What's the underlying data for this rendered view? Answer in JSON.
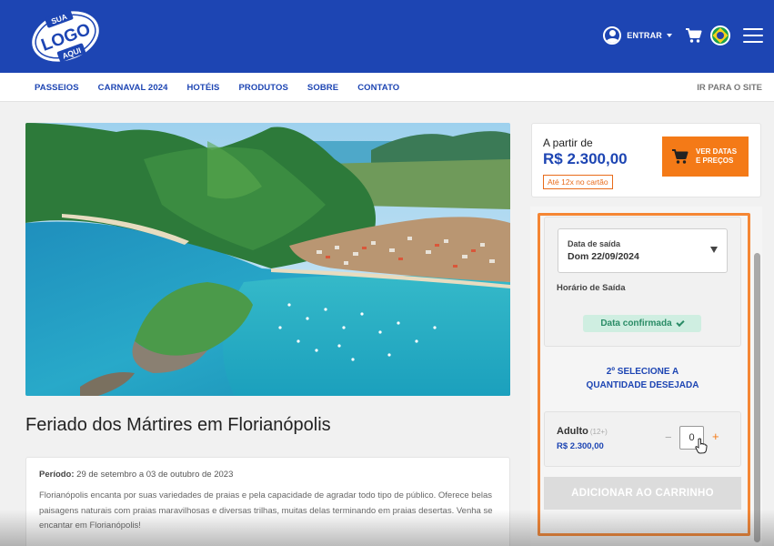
{
  "header": {
    "logo": {
      "top": "SUA",
      "middle": "LOGO",
      "bottom": "AQUI"
    },
    "login_label": "ENTRAR",
    "icons": {
      "user": "user-circle-icon",
      "cart": "shopping-cart-icon",
      "flag": "brazil-flag-icon",
      "menu": "hamburger-menu-icon"
    },
    "brand_color": "#1d45b3"
  },
  "nav": {
    "items": [
      {
        "label": "PASSEIOS"
      },
      {
        "label": "CARNAVAL 2024"
      },
      {
        "label": "HOTÉIS"
      },
      {
        "label": "PRODUTOS"
      },
      {
        "label": "SOBRE"
      },
      {
        "label": "CONTATO"
      }
    ],
    "site_link": "IR PARA O SITE"
  },
  "product": {
    "title": "Feriado dos Mártires em Florianópolis",
    "periodo_label": "Período:",
    "periodo_value": " 29 de setembro a 03 de outubro de 2023",
    "description": "Florianópolis encanta por suas variedades de praias e pela capacidade de agradar todo tipo de público. Oferece belas paisagens naturais com praias maravilhosas e diversas trilhas, muitas delas terminando em praias desertas. Venha se encantar em Florianópolis!"
  },
  "pricing": {
    "from_label": "A partir de",
    "price": "R$ 2.300,00",
    "installments": "Até 12x no cartão",
    "button_line1": "VER DATAS",
    "button_line2": "E PREÇOS",
    "accent_color": "#f47a17"
  },
  "booking": {
    "date_label": "Data de saída",
    "date_value": "Dom 22/09/2024",
    "horario_label": "Horário de Saída",
    "confirmed_label": "Data confirmada",
    "step2_line1": "2º SELECIONE A",
    "step2_line2": "QUANTIDADE DESEJADA",
    "adult_label": "Adulto",
    "adult_age": "(12+)",
    "adult_price": "R$ 2.300,00",
    "minus": "−",
    "plus": "+",
    "quantity": "0",
    "add_button": "ADICIONAR AO CARRINHO"
  }
}
